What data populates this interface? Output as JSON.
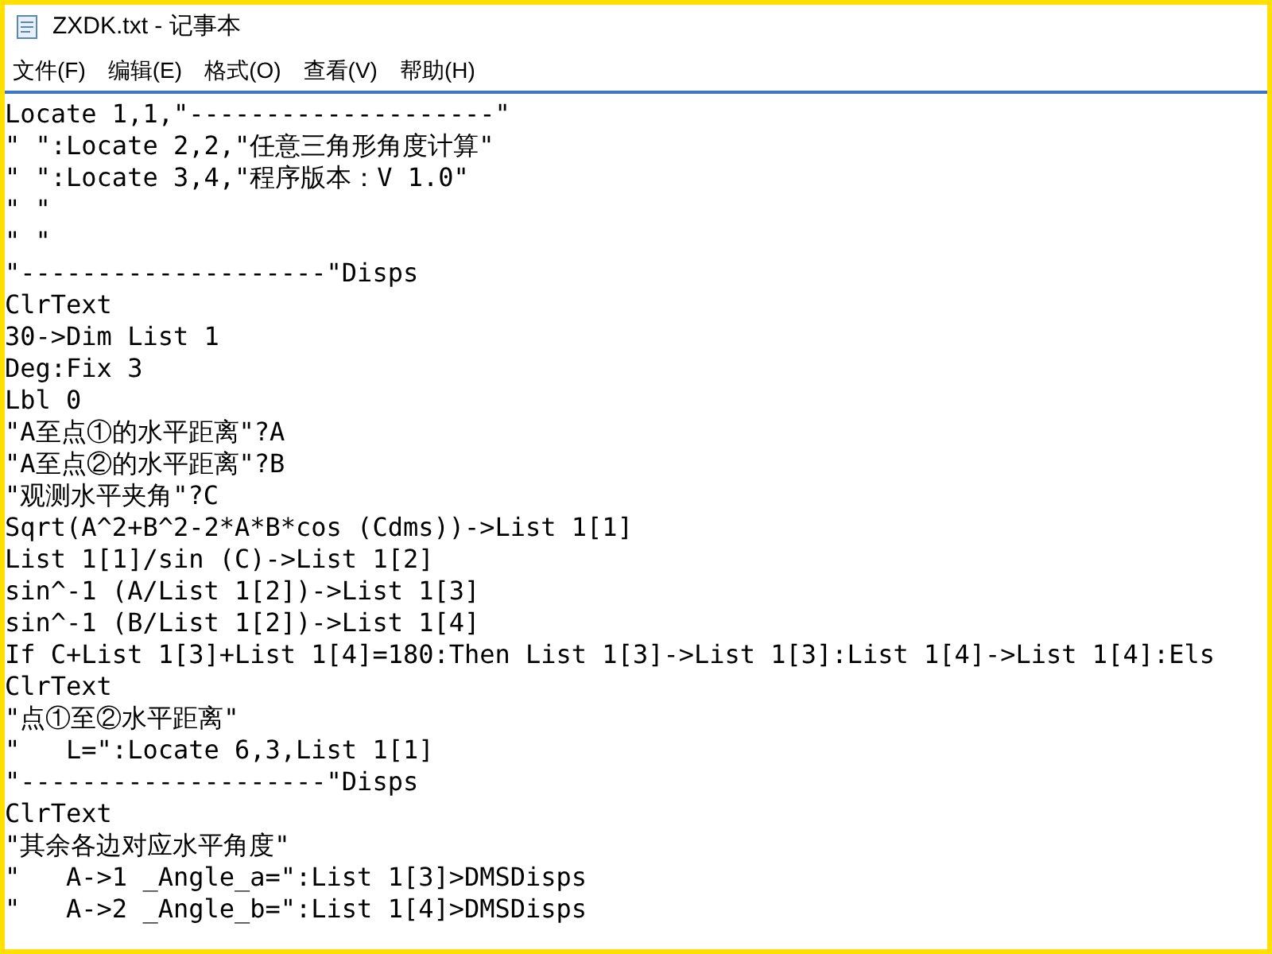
{
  "window": {
    "title": "ZXDK.txt - 记事本"
  },
  "menu": [
    "文件(F)",
    "编辑(E)",
    "格式(O)",
    "查看(V)",
    "帮助(H)"
  ],
  "editor": {
    "lines": [
      "Locate 1,1,\"--------------------\"",
      "\" \":Locate 2,2,\"任意三角形角度计算\"",
      "\" \":Locate 3,4,\"程序版本：V 1.0\"",
      "\" \"",
      "\" \"",
      "\"--------------------\"Disps",
      "ClrText",
      "30->Dim List 1",
      "Deg:Fix 3",
      "Lbl 0",
      "\"A至点①的水平距离\"?A",
      "\"A至点②的水平距离\"?B",
      "\"观测水平夹角\"?C",
      "Sqrt(A^2+B^2-2*A*B*cos (Cdms))->List 1[1]",
      "List 1[1]/sin (C)->List 1[2]",
      "sin^-1 (A/List 1[2])->List 1[3]",
      "sin^-1 (B/List 1[2])->List 1[4]",
      "If C+List 1[3]+List 1[4]=180:Then List 1[3]->List 1[3]:List 1[4]->List 1[4]:Els",
      "ClrText",
      "\"点①至②水平距离\"",
      "\"   L=\":Locate 6,3,List 1[1]",
      "\"--------------------\"Disps",
      "ClrText",
      "\"其余各边对应水平角度\"",
      "\"   A->1 _Angle_a=\":List 1[3]>DMSDisps",
      "\"   A->2 _Angle_b=\":List 1[4]>DMSDisps"
    ]
  }
}
